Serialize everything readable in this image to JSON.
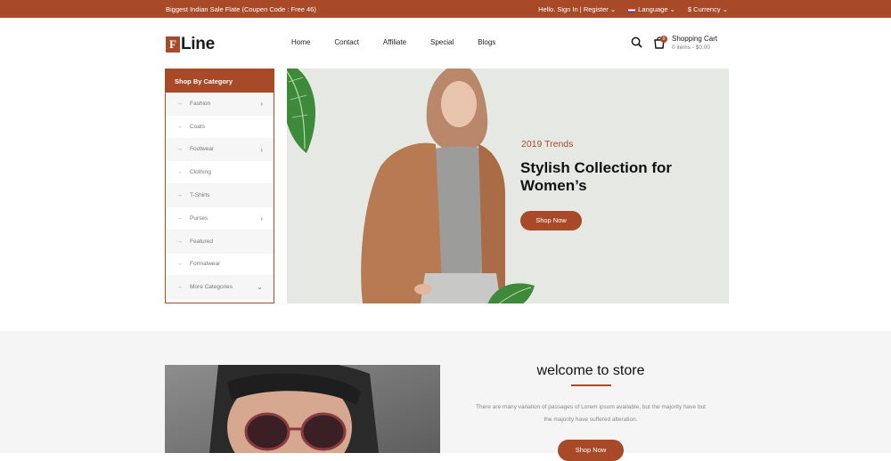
{
  "topbar": {
    "promo": "Biggest Indian Sale Flate (Coupen Code : Free 46)",
    "account": "Hello. Sign In | Register",
    "language": "Language",
    "currency": "$ Currency"
  },
  "header": {
    "logo_letter": "F",
    "logo_word": "Line",
    "nav": [
      "Home",
      "Contact",
      "Affiliate",
      "Special",
      "Blogs"
    ],
    "cart_title": "Shopping Cart",
    "cart_summary": "0 items - $0.00",
    "cart_count": "0"
  },
  "sidebar": {
    "title": "Shop By Category",
    "items": [
      {
        "label": "Fashion",
        "has_sub": true
      },
      {
        "label": "Coats",
        "has_sub": false
      },
      {
        "label": "Footwear",
        "has_sub": true
      },
      {
        "label": "Clothing",
        "has_sub": false
      },
      {
        "label": "T-Shirts",
        "has_sub": false
      },
      {
        "label": "Purses",
        "has_sub": true
      },
      {
        "label": "Featured",
        "has_sub": false
      },
      {
        "label": "Formalwear",
        "has_sub": false
      },
      {
        "label": "More Categories",
        "has_sub": true
      }
    ]
  },
  "hero": {
    "subtitle": "2019 Trends",
    "title": "Stylish Collection for Women’s",
    "button": "Shop Now"
  },
  "welcome": {
    "title": "welcome to store",
    "description": "There are many variation of passages of Lorem ipsum available, but the majority have but the majority have suffered alteration.",
    "button": "Shop Now"
  },
  "colors": {
    "accent": "#a84a28",
    "hero_bg": "#e6e9e3",
    "section_bg": "#f5f5f5"
  }
}
